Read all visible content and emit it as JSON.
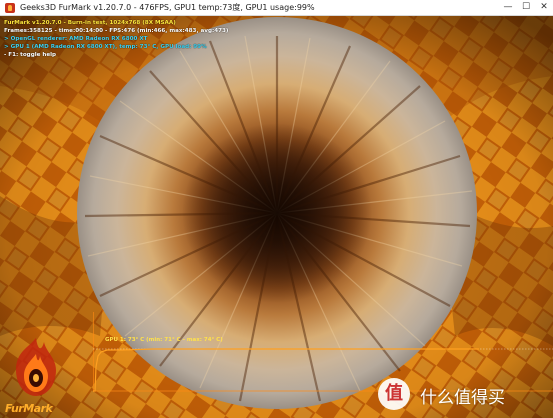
{
  "window": {
    "title": "Geeks3D FurMark v1.20.7.0 - 476FPS, GPU1 temp:73度, GPU1 usage:99%",
    "icon": "furmark-app-icon",
    "controls": {
      "minimize": "—",
      "maximize": "☐",
      "close": "✕"
    }
  },
  "osd": {
    "line1": "FurMark v1.20.7.0 - Burn-in test, 1024x768 (8X MSAA)",
    "line2": "Frames:358125 - time:00:14:00 - FPS:476 (min:466, max:483, avg:473)",
    "line3": "> OpenGL renderer: AMD Radeon RX 6800 XT",
    "line4": "> GPU 1 (AMD Radeon RX 6800 XT), temp: 73° C, GPU load: 99%",
    "line5": "- F1: toggle help"
  },
  "temp_graph": {
    "label": "GPU 1: 73° C (min: 71° C - max: 74° C)",
    "current_c": 73,
    "min_c": 71,
    "max_c": 74,
    "line_color": "#ffa020"
  },
  "logo": {
    "text": "FurMark",
    "icon": "furmark-flame-logo-icon"
  },
  "watermark": {
    "icon_glyph": "值",
    "text": "什么值得买"
  },
  "colors": {
    "osd_title": "#ffe63c",
    "osd_info": "#3fd2f0",
    "accent_orange": "#ff9a1a"
  }
}
